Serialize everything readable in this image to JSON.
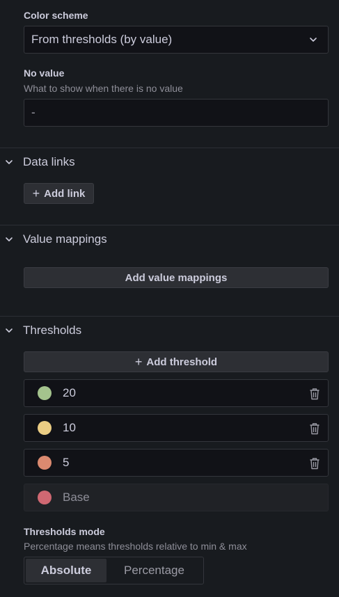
{
  "color_scheme": {
    "label": "Color scheme",
    "value": "From thresholds (by value)"
  },
  "no_value": {
    "label": "No value",
    "description": "What to show when there is no value",
    "value": "-"
  },
  "data_links": {
    "title": "Data links",
    "add_button": "Add link"
  },
  "value_mappings": {
    "title": "Value mappings",
    "add_button": "Add value mappings"
  },
  "thresholds": {
    "title": "Thresholds",
    "add_button": "Add threshold",
    "items": [
      {
        "value": "20",
        "color": "#a4c38d"
      },
      {
        "value": "10",
        "color": "#ebcd84"
      },
      {
        "value": "5",
        "color": "#db8a70"
      },
      {
        "value": "Base",
        "color": "#d06872"
      }
    ]
  },
  "thresholds_mode": {
    "label": "Thresholds mode",
    "description": "Percentage means thresholds relative to min & max",
    "options": [
      "Absolute",
      "Percentage"
    ],
    "selected": "Absolute"
  }
}
